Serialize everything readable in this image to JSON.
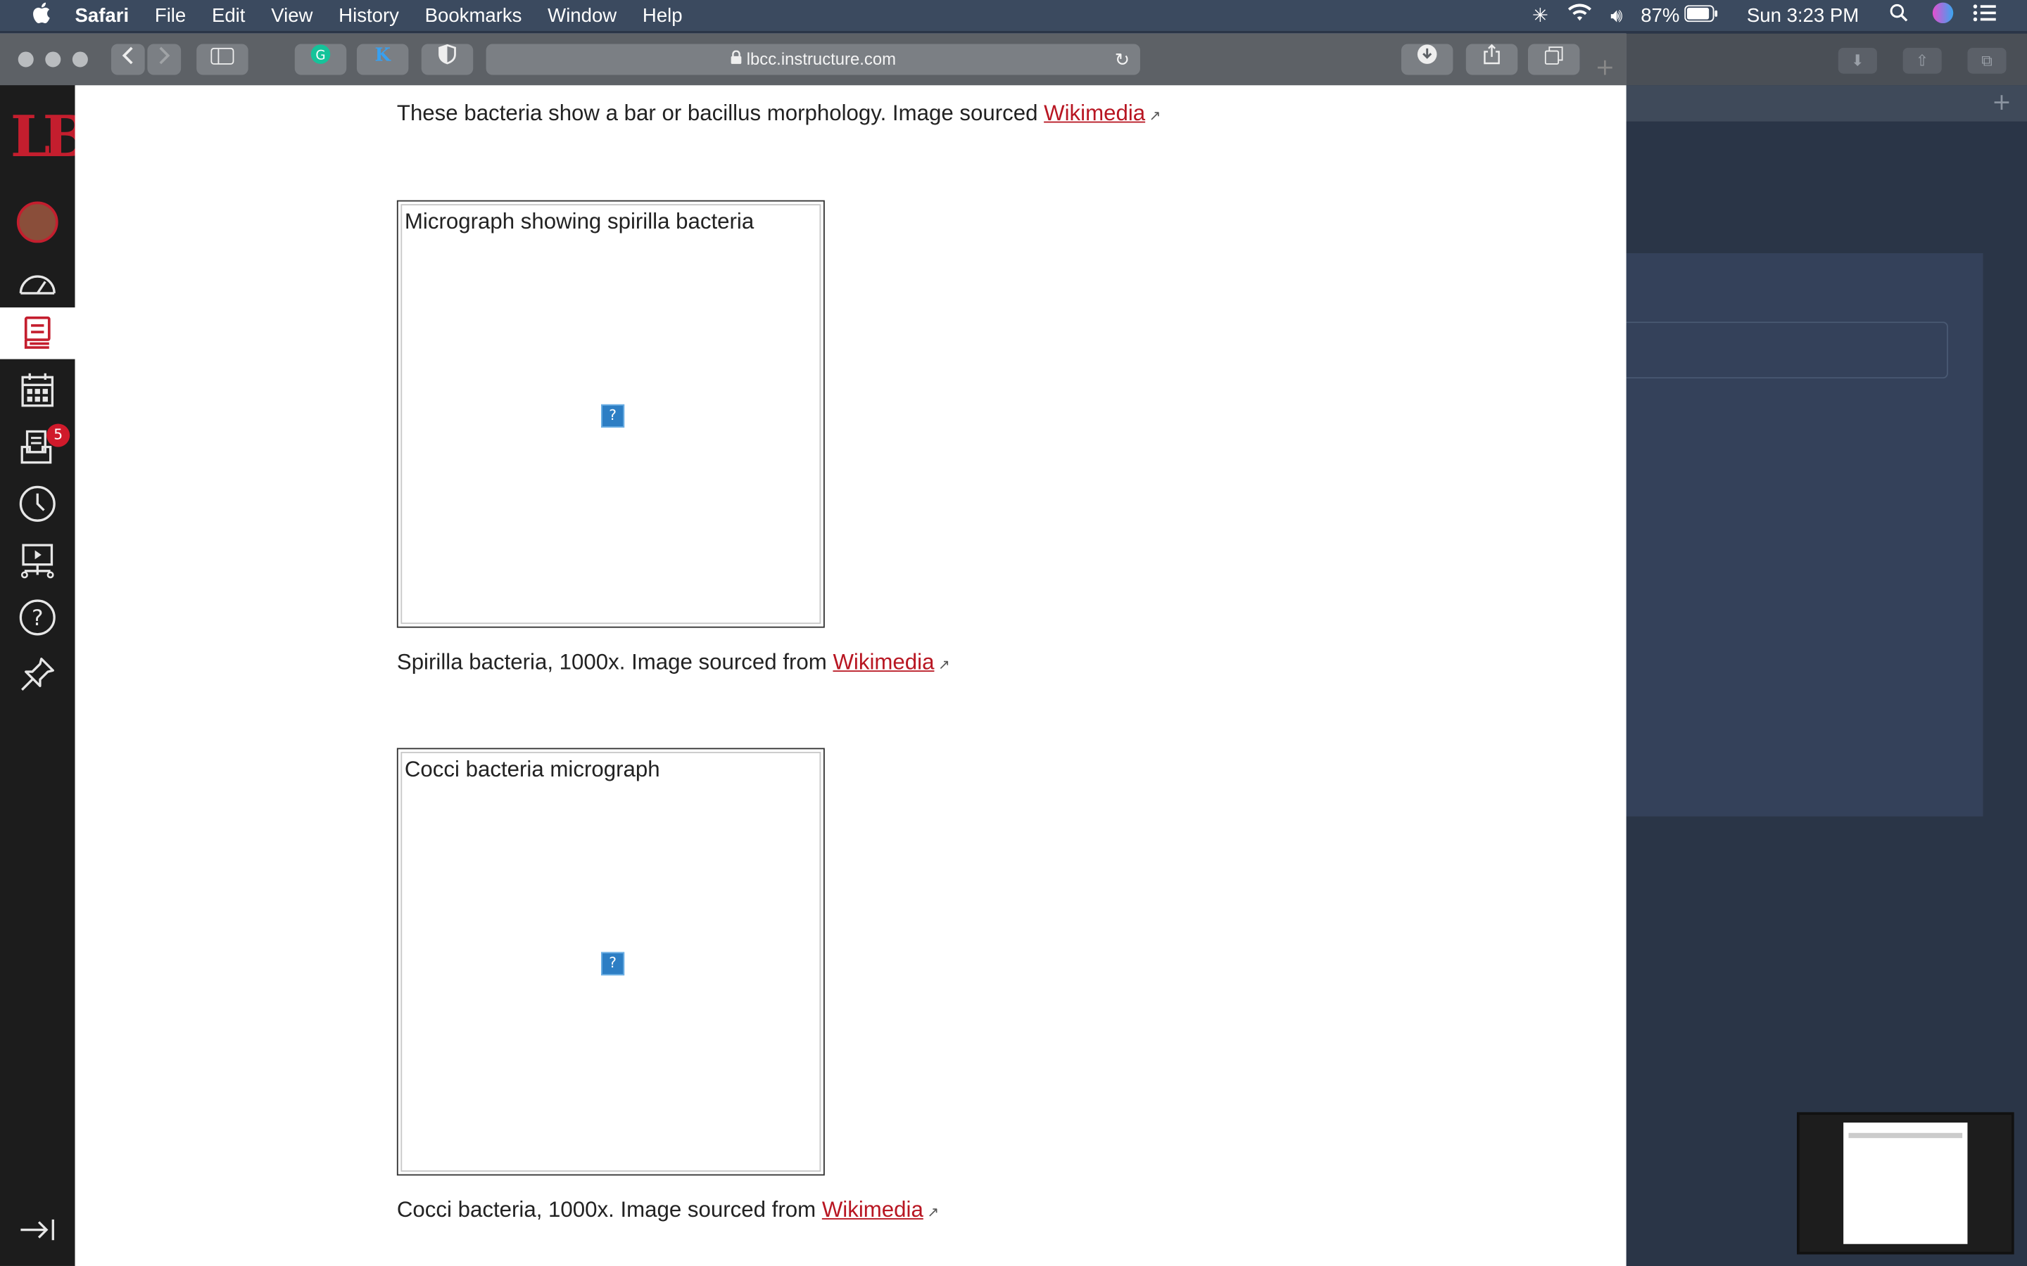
{
  "menubar": {
    "apple": "",
    "app": "Safari",
    "items": [
      "File",
      "Edit",
      "View",
      "History",
      "Bookmarks",
      "Window",
      "Help"
    ],
    "battery": "87%",
    "clock": "Sun 3:23 PM"
  },
  "browser": {
    "url": "lbcc.instructure.com"
  },
  "sidebar": {
    "logo": "LB",
    "inbox_badge": "5"
  },
  "content": {
    "intro_text": "These bacteria show a bar or bacillus morphology. Image sourced ",
    "intro_link": "Wikimedia",
    "figure1_alt": "Micrograph showing spirilla bacteria",
    "caption1_text": "Spirilla bacteria, 1000x. Image sourced from ",
    "caption1_link": "Wikimedia",
    "figure2_alt": "Cocci bacteria micrograph",
    "caption2_text": "Cocci bacteria, 1000x. Image sourced from ",
    "caption2_link": "Wikimedia",
    "broken_image_glyph": "?"
  },
  "colors": {
    "brand_red": "#c41e2e",
    "link_red": "#b81622",
    "sidebar_bg": "#1c1c1c"
  }
}
